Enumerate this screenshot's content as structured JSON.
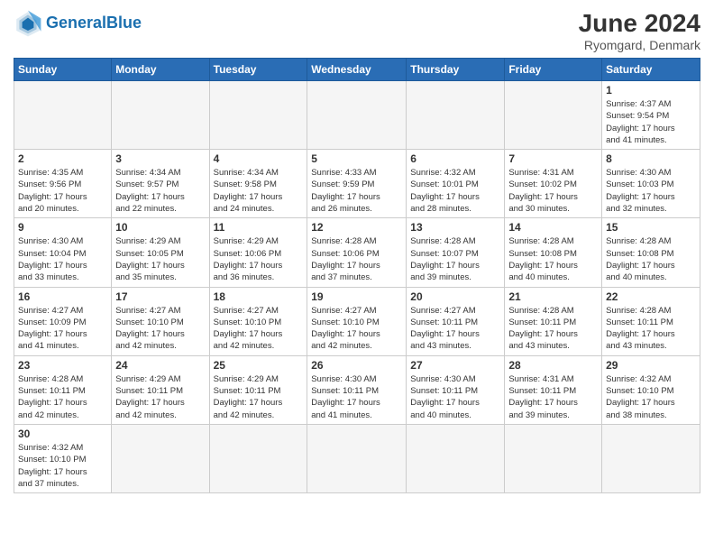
{
  "logo": {
    "text_general": "General",
    "text_blue": "Blue"
  },
  "header": {
    "title": "June 2024",
    "subtitle": "Ryomgard, Denmark"
  },
  "weekdays": [
    "Sunday",
    "Monday",
    "Tuesday",
    "Wednesday",
    "Thursday",
    "Friday",
    "Saturday"
  ],
  "weeks": [
    [
      {
        "day": "",
        "info": ""
      },
      {
        "day": "",
        "info": ""
      },
      {
        "day": "",
        "info": ""
      },
      {
        "day": "",
        "info": ""
      },
      {
        "day": "",
        "info": ""
      },
      {
        "day": "",
        "info": ""
      },
      {
        "day": "1",
        "info": "Sunrise: 4:37 AM\nSunset: 9:54 PM\nDaylight: 17 hours\nand 41 minutes."
      }
    ],
    [
      {
        "day": "2",
        "info": "Sunrise: 4:35 AM\nSunset: 9:56 PM\nDaylight: 17 hours\nand 20 minutes."
      },
      {
        "day": "3",
        "info": "Sunrise: 4:34 AM\nSunset: 9:57 PM\nDaylight: 17 hours\nand 22 minutes."
      },
      {
        "day": "4",
        "info": "Sunrise: 4:34 AM\nSunset: 9:58 PM\nDaylight: 17 hours\nand 24 minutes."
      },
      {
        "day": "5",
        "info": "Sunrise: 4:33 AM\nSunset: 9:59 PM\nDaylight: 17 hours\nand 26 minutes."
      },
      {
        "day": "6",
        "info": "Sunrise: 4:32 AM\nSunset: 10:01 PM\nDaylight: 17 hours\nand 28 minutes."
      },
      {
        "day": "7",
        "info": "Sunrise: 4:31 AM\nSunset: 10:02 PM\nDaylight: 17 hours\nand 30 minutes."
      },
      {
        "day": "8",
        "info": "Sunrise: 4:30 AM\nSunset: 10:03 PM\nDaylight: 17 hours\nand 32 minutes."
      }
    ],
    [
      {
        "day": "9",
        "info": "Sunrise: 4:30 AM\nSunset: 10:04 PM\nDaylight: 17 hours\nand 33 minutes."
      },
      {
        "day": "10",
        "info": "Sunrise: 4:29 AM\nSunset: 10:05 PM\nDaylight: 17 hours\nand 35 minutes."
      },
      {
        "day": "11",
        "info": "Sunrise: 4:29 AM\nSunset: 10:06 PM\nDaylight: 17 hours\nand 36 minutes."
      },
      {
        "day": "12",
        "info": "Sunrise: 4:28 AM\nSunset: 10:06 PM\nDaylight: 17 hours\nand 37 minutes."
      },
      {
        "day": "13",
        "info": "Sunrise: 4:28 AM\nSunset: 10:07 PM\nDaylight: 17 hours\nand 39 minutes."
      },
      {
        "day": "14",
        "info": "Sunrise: 4:28 AM\nSunset: 10:08 PM\nDaylight: 17 hours\nand 40 minutes."
      },
      {
        "day": "15",
        "info": "Sunrise: 4:28 AM\nSunset: 10:08 PM\nDaylight: 17 hours\nand 40 minutes."
      }
    ],
    [
      {
        "day": "16",
        "info": "Sunrise: 4:27 AM\nSunset: 10:09 PM\nDaylight: 17 hours\nand 41 minutes."
      },
      {
        "day": "17",
        "info": "Sunrise: 4:27 AM\nSunset: 10:10 PM\nDaylight: 17 hours\nand 42 minutes."
      },
      {
        "day": "18",
        "info": "Sunrise: 4:27 AM\nSunset: 10:10 PM\nDaylight: 17 hours\nand 42 minutes."
      },
      {
        "day": "19",
        "info": "Sunrise: 4:27 AM\nSunset: 10:10 PM\nDaylight: 17 hours\nand 42 minutes."
      },
      {
        "day": "20",
        "info": "Sunrise: 4:27 AM\nSunset: 10:11 PM\nDaylight: 17 hours\nand 43 minutes."
      },
      {
        "day": "21",
        "info": "Sunrise: 4:28 AM\nSunset: 10:11 PM\nDaylight: 17 hours\nand 43 minutes."
      },
      {
        "day": "22",
        "info": "Sunrise: 4:28 AM\nSunset: 10:11 PM\nDaylight: 17 hours\nand 43 minutes."
      }
    ],
    [
      {
        "day": "23",
        "info": "Sunrise: 4:28 AM\nSunset: 10:11 PM\nDaylight: 17 hours\nand 42 minutes."
      },
      {
        "day": "24",
        "info": "Sunrise: 4:29 AM\nSunset: 10:11 PM\nDaylight: 17 hours\nand 42 minutes."
      },
      {
        "day": "25",
        "info": "Sunrise: 4:29 AM\nSunset: 10:11 PM\nDaylight: 17 hours\nand 42 minutes."
      },
      {
        "day": "26",
        "info": "Sunrise: 4:30 AM\nSunset: 10:11 PM\nDaylight: 17 hours\nand 41 minutes."
      },
      {
        "day": "27",
        "info": "Sunrise: 4:30 AM\nSunset: 10:11 PM\nDaylight: 17 hours\nand 40 minutes."
      },
      {
        "day": "28",
        "info": "Sunrise: 4:31 AM\nSunset: 10:11 PM\nDaylight: 17 hours\nand 39 minutes."
      },
      {
        "day": "29",
        "info": "Sunrise: 4:32 AM\nSunset: 10:10 PM\nDaylight: 17 hours\nand 38 minutes."
      }
    ],
    [
      {
        "day": "30",
        "info": "Sunrise: 4:32 AM\nSunset: 10:10 PM\nDaylight: 17 hours\nand 37 minutes."
      },
      {
        "day": "",
        "info": ""
      },
      {
        "day": "",
        "info": ""
      },
      {
        "day": "",
        "info": ""
      },
      {
        "day": "",
        "info": ""
      },
      {
        "day": "",
        "info": ""
      },
      {
        "day": "",
        "info": ""
      }
    ]
  ]
}
